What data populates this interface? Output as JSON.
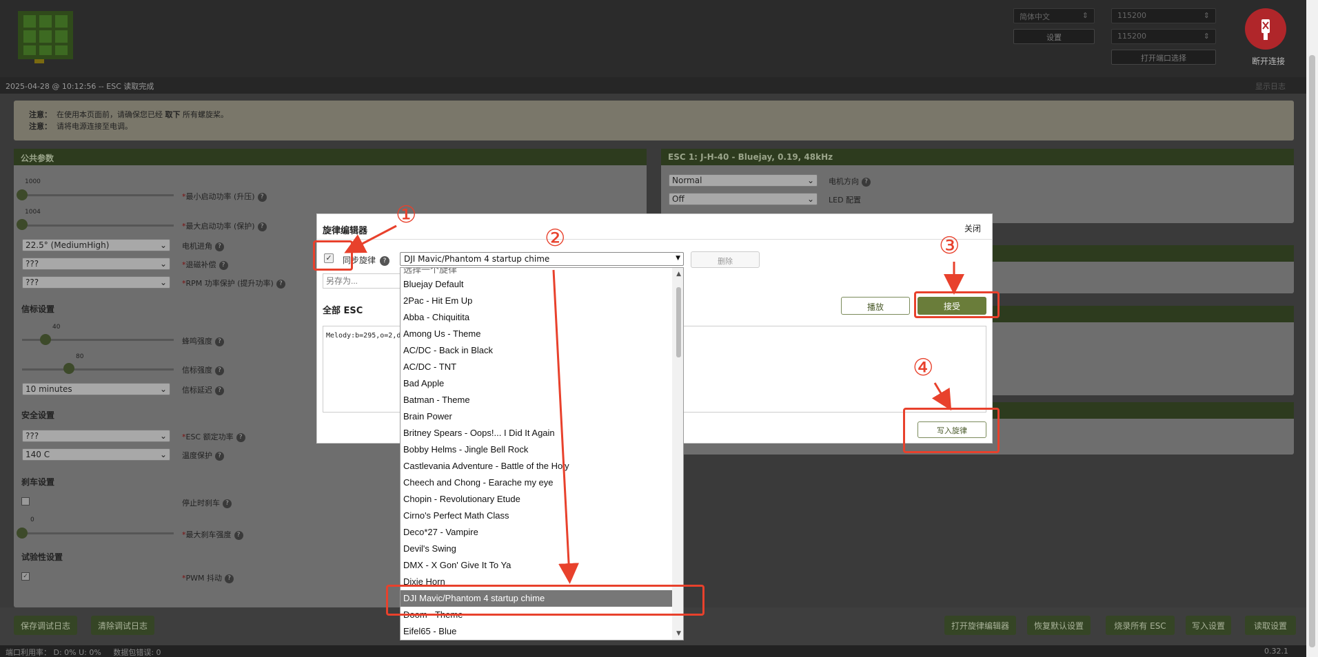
{
  "header": {
    "language": "简体中文",
    "settings_button": "设置",
    "baud1": "115200",
    "baud2": "115200",
    "open_port_button": "打开端口选择",
    "disconnect_label": "断开连接"
  },
  "status": {
    "message": "2025-04-28 @ 10:12:56 -- ESC 读取完成",
    "show_log": "显示日志"
  },
  "notice": {
    "label1": "注意：",
    "text1a": "在使用本页面前，请确保您已经",
    "text1b": "取下",
    "text1c": "所有螺旋桨。",
    "label2": "注意：",
    "text2": "请将电源连接至电调。"
  },
  "common": {
    "title": "公共参数",
    "startup_min_value": "1000",
    "startup_min_label": "最小启动功率 (升压)",
    "startup_max_value": "1004",
    "startup_max_label": "最大启动功率 (保护)",
    "timing_value": "22.5° (MediumHigh)",
    "timing_label": "电机进角",
    "demag_value": "???",
    "demag_label": "退磁补偿",
    "rpm_value": "???",
    "rpm_label": "RPM 功率保护 (提升功率)",
    "beacon_section": "信标设置",
    "beep_value": "40",
    "beep_label": "蜂鸣强度",
    "beacon_value": "80",
    "beacon_label": "信标强度",
    "beacon_delay_value": "10 minutes",
    "beacon_delay_label": "信标延迟",
    "safety_section": "安全设置",
    "esc_rating_value": "???",
    "esc_rating_label": "ESC 额定功率",
    "temp_value": "140 C",
    "temp_label": "温度保护",
    "brake_section": "刹车设置",
    "brake_stop_label": "停止时刹车",
    "brake_max_value": "0",
    "brake_max_label": "最大刹车强度",
    "exp_section": "试验性设置",
    "pwm_label": "PWM 抖动"
  },
  "esc1": {
    "title": "ESC 1: J-H-40 - Bluejay, 0.19, 48kHz",
    "direction_value": "Normal",
    "direction_label": "电机方向",
    "led_value": "Off",
    "led_label": "LED 配置"
  },
  "bottom": {
    "save_log": "保存调试日志",
    "clear_log": "清除调试日志",
    "open_melody": "打开旋律编辑器",
    "restore_default": "恢复默认设置",
    "flash_all": "烧录所有 ESC",
    "write_settings": "写入设置",
    "read_settings": "读取设置"
  },
  "footer": {
    "port_usage": "端口利用率：  D: 0% U: 0%",
    "packet_errors": "数据包错误: 0",
    "version": "0.32.1"
  },
  "modal": {
    "title": "旋律编辑器",
    "close": "关闭",
    "sync_label": "同步旋律",
    "selected_melody": "DJI Mavic/Phantom 4 startup chime",
    "delete_button": "删除",
    "saveas_placeholder": "另存为...",
    "all_esc": "全部 ESC",
    "play_button": "播放",
    "accept_button": "接受",
    "melody_text": "Melody:b=295,o=2,d",
    "write_button": "写入旋律"
  },
  "dropdown": {
    "top_partial": "选择一个旋律",
    "items": [
      "Bluejay Default",
      "2Pac - Hit Em Up",
      "Abba - Chiquitita",
      "Among Us - Theme",
      "AC/DC - Back in Black",
      "AC/DC - TNT",
      "Bad Apple",
      "Batman - Theme",
      "Brain Power",
      "Britney Spears - Oops!... I Did It Again",
      "Bobby Helms - Jingle Bell Rock",
      "Castlevania Adventure - Battle of the Holy",
      "Cheech and Chong - Earache my eye",
      "Chopin - Revolutionary Etude",
      "Cirno's Perfect Math Class",
      "Deco*27 - Vampire",
      "Devil's Swing",
      "DMX - X Gon' Give It To Ya",
      "Dixie Horn",
      "DJI Mavic/Phantom 4 startup chime",
      "Doom - Theme",
      "Eifel65 - Blue"
    ]
  },
  "annotations": [
    "①",
    "②",
    "③",
    "④"
  ],
  "colors": {
    "annotation": "#e8412c",
    "accent": "#6a7d3a",
    "panel_header": "#2d3b1e"
  }
}
